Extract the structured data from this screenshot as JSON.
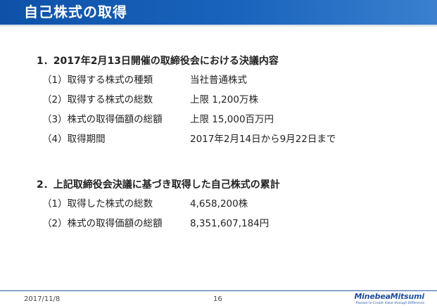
{
  "header": {
    "title": "自己株式の取得",
    "bar_color": "#1a5cb3"
  },
  "section1": {
    "heading": "1．2017年2月13日開催の取締役会における決議内容",
    "rows": [
      {
        "label": "（1）取得する株式の種類",
        "value": "当社普通株式"
      },
      {
        "label": "（2）取得する株式の総数",
        "value": "上限 1,200万株"
      },
      {
        "label": "（3）株式の取得価額の総額",
        "value": "上限 15,000百万円"
      },
      {
        "label": "（4）取得期間",
        "value": "2017年2月14日から9月22日まで"
      }
    ]
  },
  "section2": {
    "heading": "2．上記取締役会決議に基づき取得した自己株式の累計",
    "rows": [
      {
        "label": "（1）取得した株式の総数",
        "value": "4,658,200株"
      },
      {
        "label": "（2）株式の取得価額の総額",
        "value": "8,351,607,184円"
      }
    ]
  },
  "footer": {
    "date": "2017/11/8",
    "page": "16",
    "logo_name": "MinebeaMitsumi",
    "logo_tagline": "Passion to Create Value through Difference",
    "line_color": "#2a5aa6"
  }
}
